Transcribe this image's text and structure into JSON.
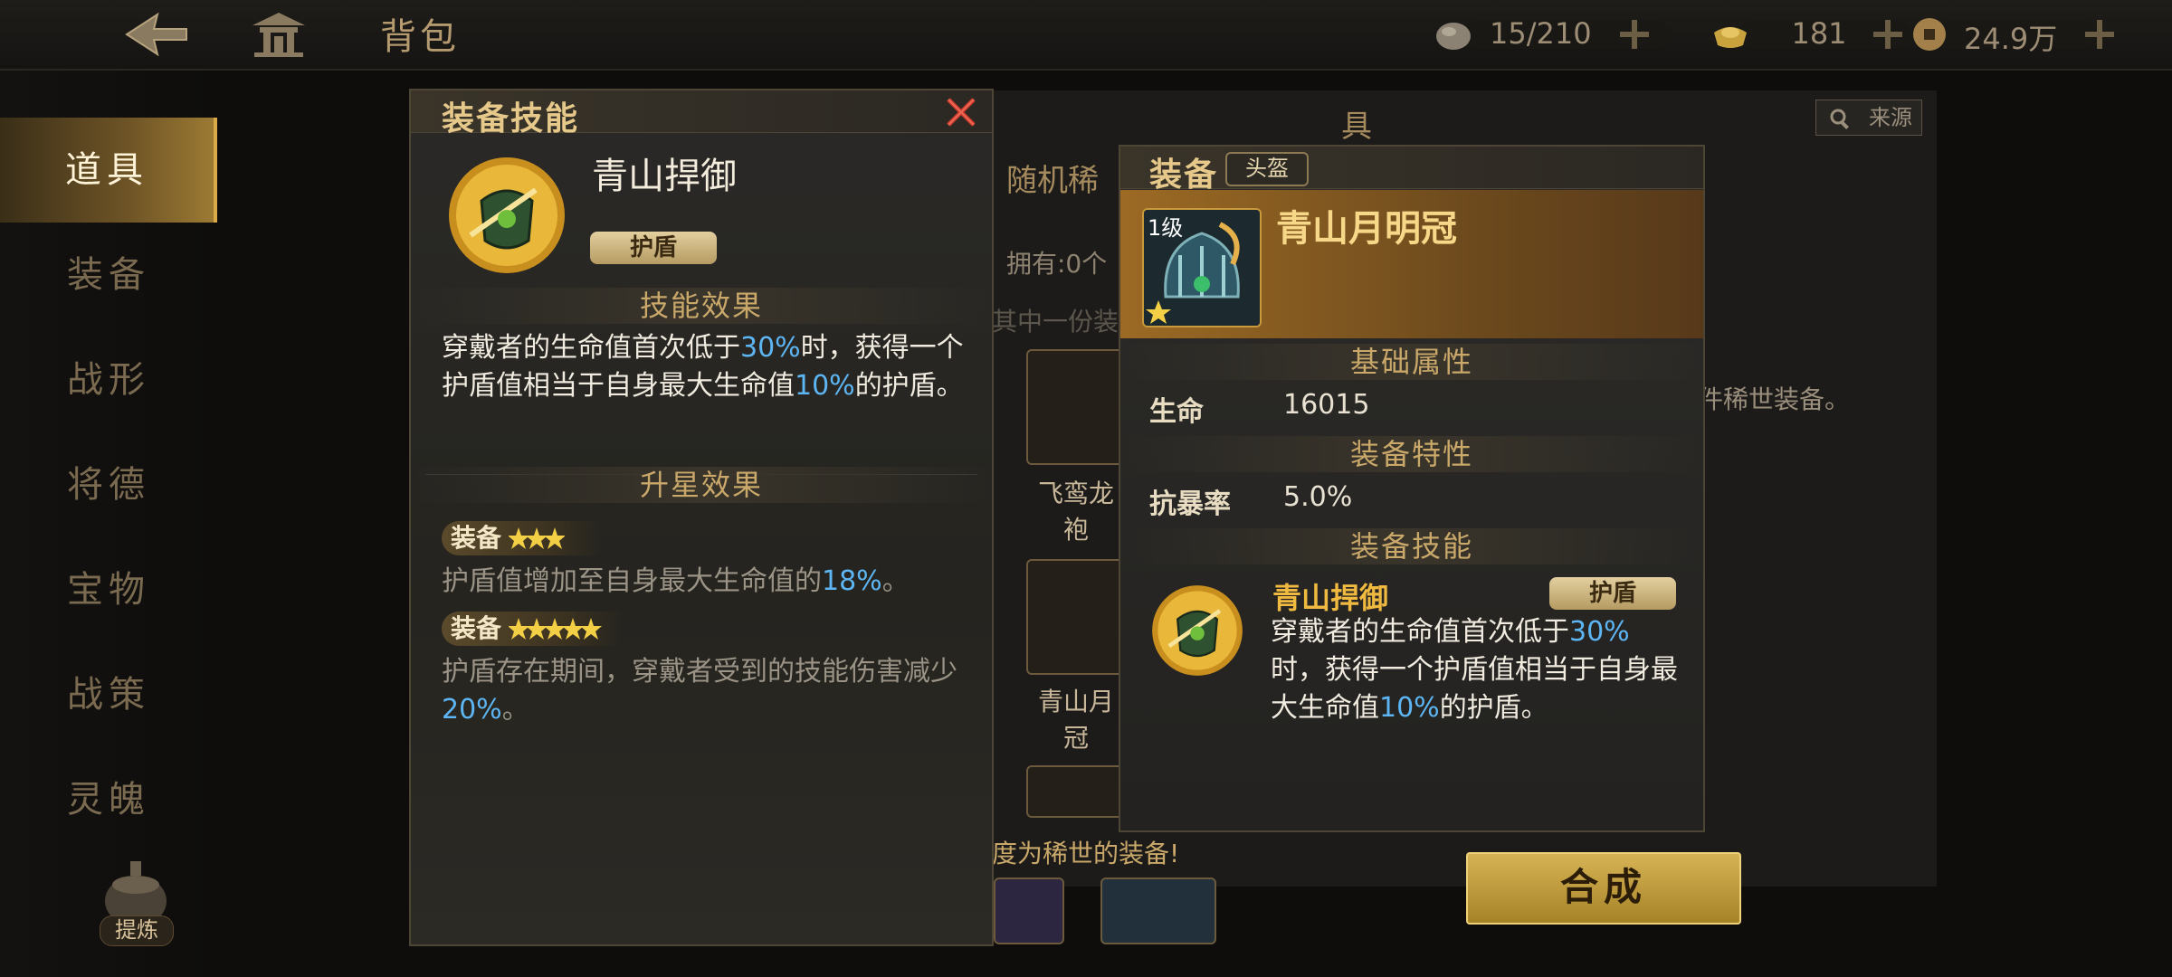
{
  "header": {
    "title": "背包",
    "resources": [
      {
        "icon": "stone-icon",
        "value": "15/210"
      },
      {
        "icon": "ingot-icon",
        "value": "181"
      },
      {
        "icon": "coin-icon",
        "value": "24.9万"
      }
    ]
  },
  "sidebar": {
    "items": [
      {
        "label": "道具",
        "active": true
      },
      {
        "label": "装备"
      },
      {
        "label": "战形"
      },
      {
        "label": "将德"
      },
      {
        "label": "宝物"
      },
      {
        "label": "战策"
      },
      {
        "label": "灵魄"
      }
    ],
    "refine_label": "提炼"
  },
  "background_panel": {
    "header_partial": "具",
    "source_button": "来源",
    "random_title_partial": "随机稀",
    "owned_partial": "拥有:0个",
    "pick_partial": "其中一份装",
    "item1_name_partial": "飞鸾龙\n袍",
    "item2_name_partial": "青山月\n冠",
    "rare_text_partial": "件稀世装备。",
    "upgrade_hint_partial": "度为稀世的装备!",
    "craft_button": "合成"
  },
  "skill_panel": {
    "title": "装备技能",
    "skill_name": "青山捍御",
    "tag": "护盾",
    "effect_title": "技能效果",
    "effect_text": [
      "穿戴者的生命值首次低于",
      "30%",
      "时，获得一个护盾值相当于自身最大生命值",
      "10%",
      "的护盾。"
    ],
    "star_title": "升星效果",
    "star_effects": [
      {
        "label": "装备",
        "stars": 3,
        "text": [
          "护盾值增加至自身最大生命值的",
          "18%",
          "。"
        ]
      },
      {
        "label": "装备",
        "stars": 5,
        "text": [
          "护盾存在期间，穿戴者受到的技能伤害减少",
          "20%",
          "。"
        ]
      }
    ]
  },
  "equip_panel": {
    "title": "装备",
    "type": "头盔",
    "level": "1级",
    "name": "青山月明冠",
    "base_attr_title": "基础属性",
    "base_stats": [
      {
        "label": "生命",
        "value": "16015"
      }
    ],
    "trait_title": "装备特性",
    "traits": [
      {
        "label": "抗暴率",
        "value": "5.0%"
      }
    ],
    "skill_title": "装备技能",
    "skill_name": "青山捍御",
    "skill_tag": "护盾",
    "skill_text": [
      "穿戴者的生命值首次低于",
      "30%",
      "时，获得一个护盾值相当于自身最大生命值",
      "10%",
      "的护盾。"
    ]
  },
  "colors": {
    "accent_gold": "#e6c98a",
    "highlight_blue": "#5db6f3",
    "dim_text": "#9a9386"
  }
}
